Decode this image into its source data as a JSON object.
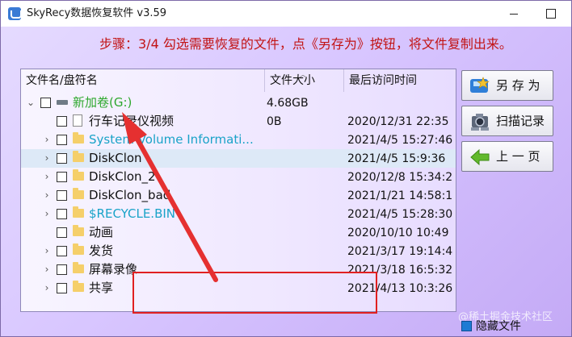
{
  "window": {
    "title": "SkyRecy数据恢复软件 v3.59"
  },
  "step": {
    "text": "步骤：3/4 勾选需要恢复的文件，点《另存为》按钮，将文件复制出来。"
  },
  "table": {
    "columns": [
      "文件名/盘符名",
      "文件大小",
      "最后访问时间"
    ],
    "rows": [
      {
        "name": "新加卷(G:)",
        "size": "4.68GB",
        "date": "",
        "icon": "drive-icon",
        "expander": "chevron-down",
        "indent": 0,
        "color": "green"
      },
      {
        "name": "行车记录仪视频",
        "size": "0B",
        "date": "2020/12/31 22:35",
        "icon": "file-icon",
        "expander": "",
        "indent": 1,
        "color": "default"
      },
      {
        "name": "System Volume Informati...",
        "size": "",
        "date": "2021/4/5 15:27:46",
        "icon": "folder-icon",
        "expander": "chevron-right",
        "indent": 1,
        "color": "cyan"
      },
      {
        "name": "DiskClon",
        "size": "",
        "date": "2021/4/5 15:9:36",
        "icon": "folder-icon",
        "expander": "chevron-right",
        "indent": 1,
        "color": "default",
        "selected": true
      },
      {
        "name": "DiskClon_2",
        "size": "",
        "date": "2020/12/8 15:34:2",
        "icon": "folder-icon",
        "expander": "chevron-right",
        "indent": 1,
        "color": "default"
      },
      {
        "name": "DiskClon_bad",
        "size": "",
        "date": "2021/1/21 14:58:1",
        "icon": "folder-icon",
        "expander": "chevron-right",
        "indent": 1,
        "color": "default"
      },
      {
        "name": "$RECYCLE.BIN",
        "size": "",
        "date": "2021/4/5 15:28:30",
        "icon": "folder-icon",
        "expander": "chevron-right",
        "indent": 1,
        "color": "cyan"
      },
      {
        "name": "动画",
        "size": "",
        "date": "2020/10/10 10:49",
        "icon": "folder-icon",
        "expander": "",
        "indent": 1,
        "color": "default"
      },
      {
        "name": "发货",
        "size": "",
        "date": "2021/3/17 19:14:4",
        "icon": "folder-icon",
        "expander": "chevron-right",
        "indent": 1,
        "color": "default"
      },
      {
        "name": "屏幕录像",
        "size": "",
        "date": "2021/3/18 16:5:32",
        "icon": "folder-icon",
        "expander": "chevron-right",
        "indent": 1,
        "color": "default"
      },
      {
        "name": "共享",
        "size": "",
        "date": "2021/4/13 10:3:26",
        "icon": "folder-icon",
        "expander": "chevron-right",
        "indent": 1,
        "color": "default"
      }
    ]
  },
  "buttons": {
    "save_as": "另 存 为",
    "scan_log": "扫描记录",
    "prev": "上 一 页"
  },
  "options": {
    "hide_files": "隐藏文件"
  },
  "watermark": {
    "text": "@稀土掘金技术社区"
  },
  "colors": {
    "step_text": "#c21313",
    "green_text": "#2ea82e",
    "cyan_text": "#1aa3c8",
    "annotation": "#e02020"
  }
}
